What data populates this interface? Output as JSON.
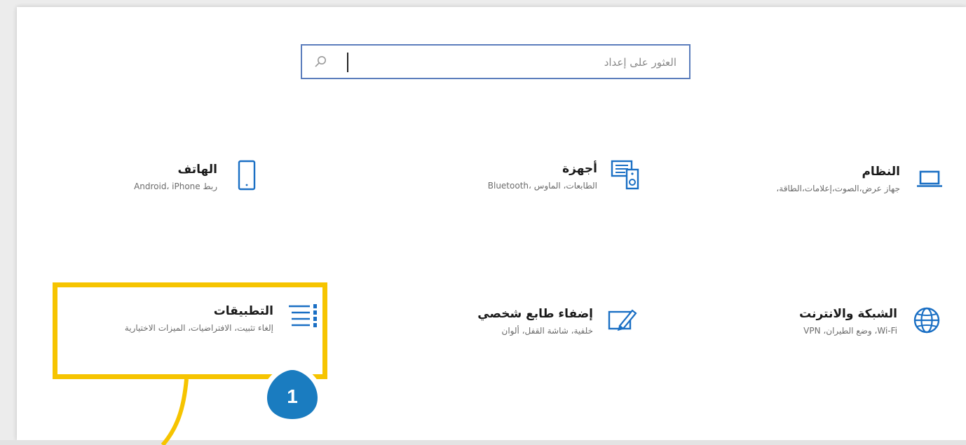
{
  "search": {
    "placeholder": "العثور على إعداد",
    "icon": "search-icon"
  },
  "tiles": [
    {
      "title": "النظام",
      "description": "جهاز عرض،الصوت،إعلامات،الطاقة،",
      "icon": "laptop-icon"
    },
    {
      "title": "أجهزة",
      "description": "الطابعات، الماوس ،Bluetooth",
      "icon": "devices-icon"
    },
    {
      "title": "الهاتف",
      "description": "ربط Android، iPhone",
      "icon": "phone-icon"
    },
    {
      "title": "الشبكة والانترنت",
      "description": "Wi-Fi، وضع الطيران، VPN",
      "icon": "globe-icon"
    },
    {
      "title": "إضفاء طابع شخصي",
      "description": "خلفية، شاشة القفل، ألوان",
      "icon": "personalization-icon"
    },
    {
      "title": "التطبيقات",
      "description": "إلغاء تثبيت، الافتراضيات، الميزات الاختيارية",
      "icon": "apps-icon"
    }
  ],
  "annotation": {
    "step_number": "1",
    "highlight_color": "#f6c400",
    "badge_color": "#1a7cc0"
  },
  "colors": {
    "accent": "#1a6fc4",
    "search_border": "#5b7dbc"
  }
}
